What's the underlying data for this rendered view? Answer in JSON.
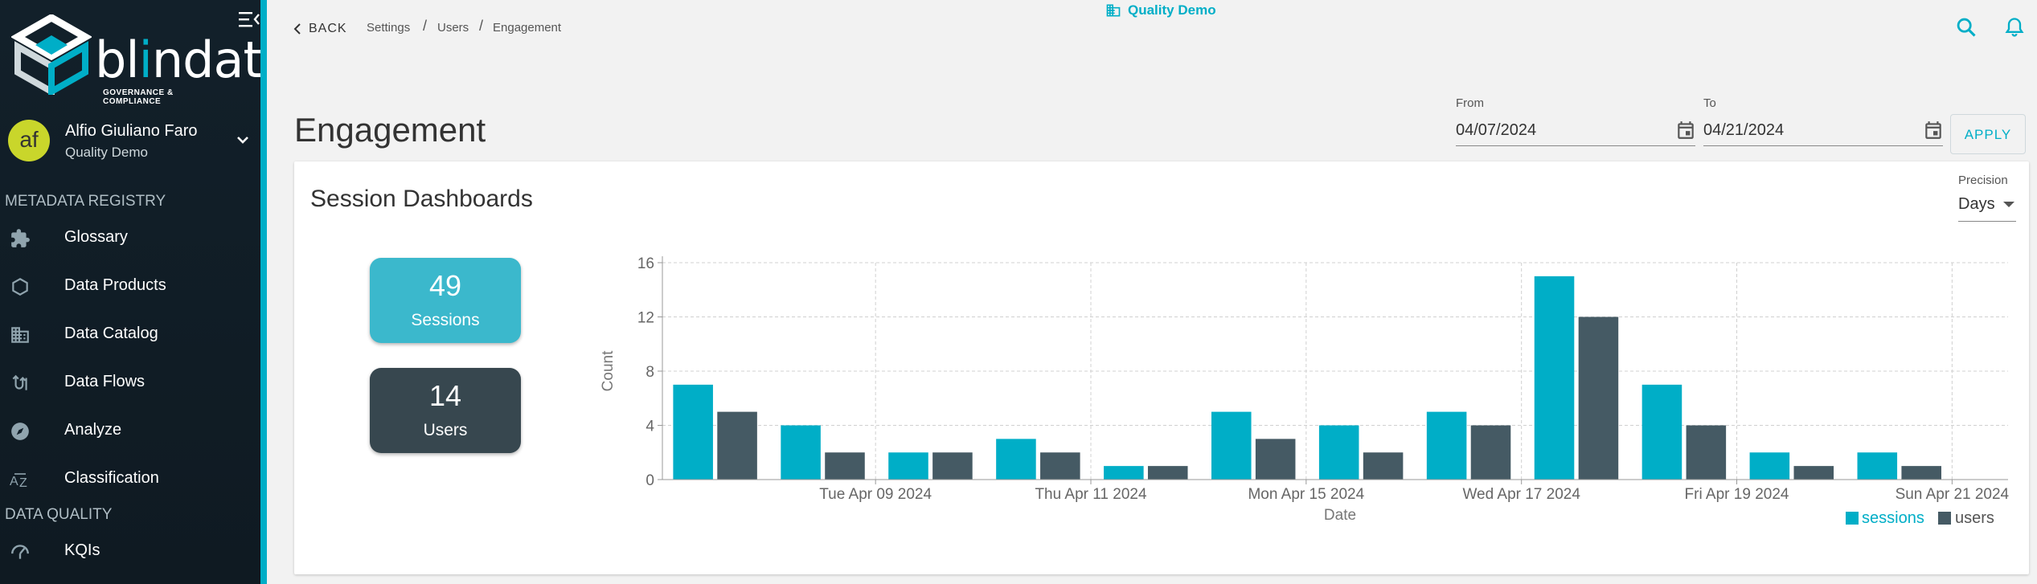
{
  "brand": {
    "name_prefix": "bl",
    "name_accent": "i",
    "name_suffix": "ndata",
    "tagline": "GOVERNANCE & COMPLIANCE",
    "accent_color": "#00aec7"
  },
  "user": {
    "initials": "af",
    "name": "Alfio Giuliano Faro",
    "org": "Quality Demo"
  },
  "sidebar": {
    "section_metadata": "METADATA REGISTRY",
    "section_quality": "DATA QUALITY",
    "items": [
      {
        "label": "Glossary",
        "icon": "puzzle-icon"
      },
      {
        "label": "Data Products",
        "icon": "hexagon-icon"
      },
      {
        "label": "Data Catalog",
        "icon": "building-icon"
      },
      {
        "label": "Data Flows",
        "icon": "flow-icon"
      },
      {
        "label": "Analyze",
        "icon": "compass-icon"
      },
      {
        "label": "Classification",
        "icon": "sort-az-icon"
      },
      {
        "label": "KQIs",
        "icon": "gauge-icon"
      }
    ]
  },
  "topbar": {
    "back_label": "BACK",
    "breadcrumb": [
      "Settings",
      "Users",
      "Engagement"
    ],
    "tenant": "Quality Demo"
  },
  "page": {
    "title": "Engagement",
    "from_label": "From",
    "from_value": "04/07/2024",
    "to_label": "To",
    "to_value": "04/21/2024",
    "apply_label": "APPLY"
  },
  "card": {
    "title": "Session Dashboards",
    "precision_label": "Precision",
    "precision_value": "Days",
    "kpis": [
      {
        "value": "49",
        "label": "Sessions",
        "color": "#3bb8cc"
      },
      {
        "value": "14",
        "label": "Users",
        "color": "#37474f"
      }
    ]
  },
  "chart_data": {
    "type": "bar",
    "xlabel": "Date",
    "ylabel": "Count",
    "ylim": [
      0,
      16
    ],
    "yticks": [
      0,
      4,
      8,
      12,
      16
    ],
    "tick_labels": [
      "Tue Apr 09 2024",
      "Thu Apr 11 2024",
      "Mon Apr 15 2024",
      "Wed Apr 17 2024",
      "Fri Apr 19 2024",
      "Sun Apr 21 2024"
    ],
    "grid": true,
    "legend_position": "bottom-right",
    "series": [
      {
        "name": "sessions",
        "color": "#00aec7",
        "values": [
          7,
          4,
          2,
          3,
          1,
          5,
          4,
          5,
          15,
          7,
          2,
          2
        ]
      },
      {
        "name": "users",
        "color": "#455a64",
        "values": [
          5,
          2,
          2,
          2,
          1,
          3,
          2,
          4,
          12,
          4,
          1,
          1
        ]
      }
    ]
  }
}
